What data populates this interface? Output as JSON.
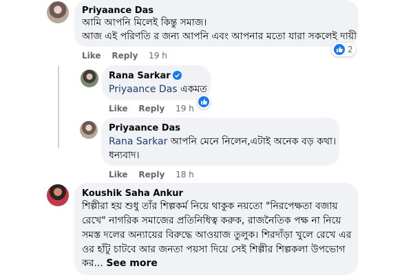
{
  "comments": [
    {
      "author": "Priyaance Das",
      "lines": [
        "আমি আপনি মিলেই কিন্তু সমাজ।",
        "আজ এই পরিণতি র জন্য আপনি এবং আপনার মতো যারা সকলেই দায়ী"
      ],
      "like": "Like",
      "reply": "Reply",
      "time": "19 h",
      "reaction_count": "2"
    },
    {
      "author": "Rana Sarkar",
      "verified": true,
      "mention": "Priyaance Das",
      "text": " একমত",
      "like": "Like",
      "reply": "Reply",
      "time": "19 h"
    },
    {
      "author": "Priyaance Das",
      "mention": "Rana Sarkar",
      "text": " আপনি মেনে নিলেন,এটাই অনেক বড় কথা।",
      "line2": "ধন্যবাদ।",
      "like": "Like",
      "reply": "Reply",
      "time": "18 h"
    },
    {
      "author": "Koushik Saha Ankur",
      "lines": [
        "শিল্পীরা হয় শুধু তাঁর শিল্পকর্ম নিয়ে থাকুক নয়তো \"নিরপেক্ষতা বজায়",
        "রেখে\" নাগরিক সমাজের প্রতিনিধিত্ব করুক, রাজনৈতিক পক্ষ না নিয়ে",
        "সমস্ত দলের অন্যায়ের বিরুদ্ধে আওয়াজ তুলুক। শিরদাঁড়া খুলে রেখে এর",
        "ওর হাঁটু চাটবে আর জনতা পয়সা দিয়ে সেই শিল্পীর শিল্পকলা উপভোগ"
      ],
      "last_line": "কর...",
      "see_more": "See more"
    }
  ],
  "colors": {
    "bubble": "#f0f2f5",
    "meta": "#65676b",
    "like_blue": "#1877f2"
  }
}
